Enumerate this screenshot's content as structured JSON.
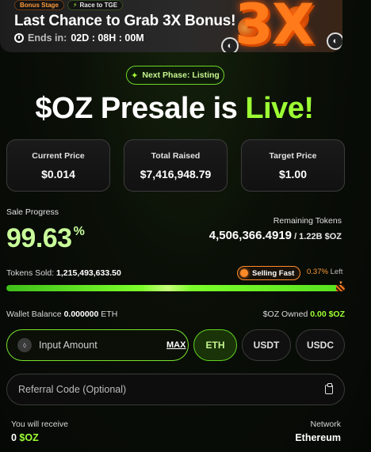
{
  "banner": {
    "chip_stage": "Bonus Stage",
    "chip_race": "Race to TGE",
    "title": "Last Chance to Grab 3X Bonus!",
    "ends_label": "Ends in:",
    "countdown": "02D : 08H : 00M",
    "bonus_graphic": "3X"
  },
  "phase": {
    "label": "Next Phase: Listing"
  },
  "headline": {
    "prefix": "$OZ Presale is ",
    "highlight": "Live!"
  },
  "stats": [
    {
      "label": "Current Price",
      "value": "$0.014"
    },
    {
      "label": "Total Raised",
      "value": "$7,416,948.79"
    },
    {
      "label": "Target Price",
      "value": "$1.00"
    }
  ],
  "progress": {
    "label": "Sale Progress",
    "percent_value": "99.63",
    "percent_sign": "%",
    "fill_percent": 99.63,
    "remaining_label": "Remaining Tokens",
    "remaining_value": "4,506,366.4919",
    "remaining_total": " / 1.22B $OZ",
    "sold_label": "Tokens Sold: ",
    "sold_value": "1,215,493,633.50",
    "selling_fast": "Selling Fast",
    "left_value": "0.37%",
    "left_label": " Left"
  },
  "balances": {
    "wallet_label": "Wallet Balance ",
    "wallet_value": "0.000000",
    "wallet_unit": " ETH",
    "owned_label": "$OZ Owned ",
    "owned_value": "0.00 $OZ"
  },
  "purchase": {
    "amount_placeholder": "Input Amount",
    "max_label": "MAX",
    "currencies": [
      "ETH",
      "USDT",
      "USDC"
    ],
    "selected_currency": "ETH",
    "referral_placeholder": "Referral Code (Optional)"
  },
  "receive": {
    "label": "You will receive",
    "amount": "0",
    "token": " $OZ",
    "network_label": "Network",
    "network_value": "Ethereum"
  },
  "colors": {
    "accent_green": "#9dff34",
    "accent_orange": "#ff8a2a",
    "background": "#060806"
  },
  "icons": [
    "timer-icon",
    "bolt-icon",
    "sparkle-icon",
    "eth-icon",
    "clipboard-icon",
    "coin-icon"
  ]
}
